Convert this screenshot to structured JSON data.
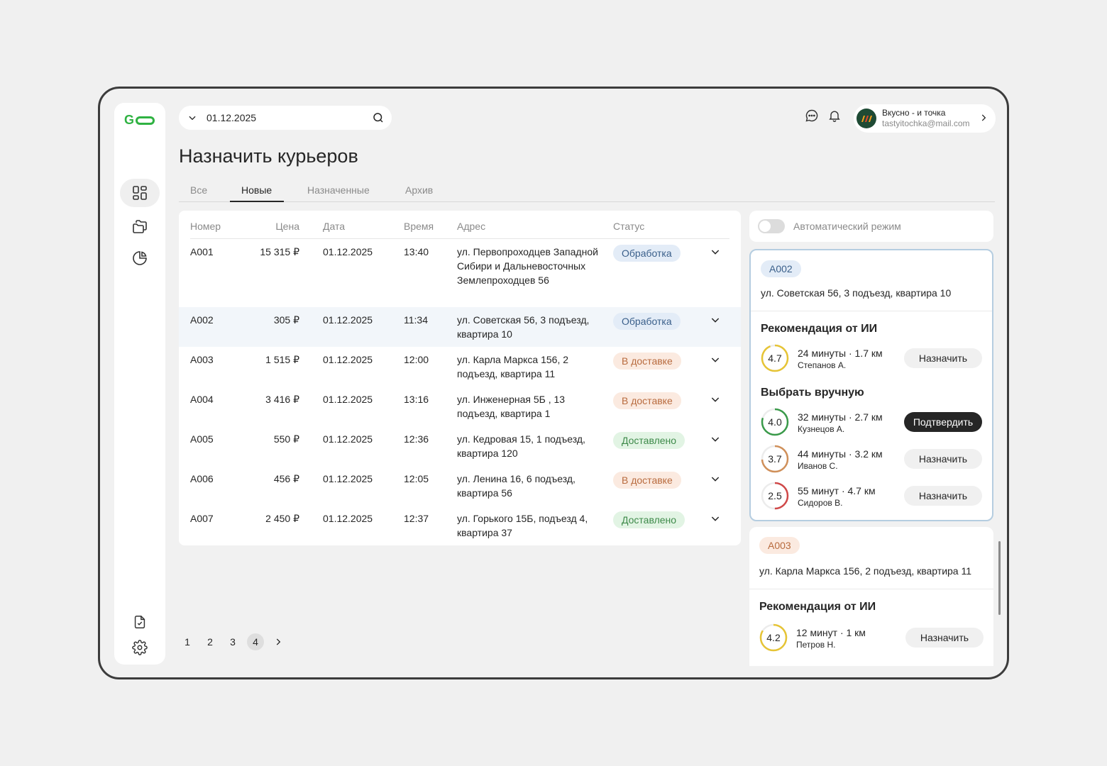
{
  "app": {
    "logo_letter": "G"
  },
  "search": {
    "value": "01.12.2025"
  },
  "user": {
    "name": "Вкусно - и точка",
    "email": "tastyitochka@mail.com"
  },
  "page_title": "Назначить курьеров",
  "tabs": [
    {
      "label": "Все"
    },
    {
      "label": "Новые"
    },
    {
      "label": "Назначенные"
    },
    {
      "label": "Архив"
    }
  ],
  "active_tab": "Новые",
  "table": {
    "headers": {
      "number": "Номер",
      "price": "Цена",
      "date": "Дата",
      "time": "Время",
      "address": "Адрес",
      "status": "Статус"
    },
    "rows": [
      {
        "number": "A001",
        "price": "15 315 ₽",
        "date": "01.12.2025",
        "time": "13:40",
        "address": "ул. Первопроходцев Западной Сибири и Дальневосточных Землепроходцев 56",
        "status": "Обработка",
        "status_type": "proc"
      },
      {
        "number": "A002",
        "price": "305 ₽",
        "date": "01.12.2025",
        "time": "11:34",
        "address": "ул. Советская 56, 3 подъезд, квартира 10",
        "status": "Обработка",
        "status_type": "proc",
        "selected": true
      },
      {
        "number": "A003",
        "price": "1 515 ₽",
        "date": "01.12.2025",
        "time": "12:00",
        "address": "ул. Карла Маркса 156, 2 подъезд, квартира 11",
        "status": "В доставке",
        "status_type": "del"
      },
      {
        "number": "A004",
        "price": "3 416 ₽",
        "date": "01.12.2025",
        "time": "13:16",
        "address": "ул. Инженерная 5Б , 13 подъезд, квартира 1",
        "status": "В доставке",
        "status_type": "del"
      },
      {
        "number": "A005",
        "price": "550 ₽",
        "date": "01.12.2025",
        "time": "12:36",
        "address": "ул. Кедровая 15, 1 подъезд, квартира 120",
        "status": "Доставлено",
        "status_type": "done"
      },
      {
        "number": "A006",
        "price": "456 ₽",
        "date": "01.12.2025",
        "time": "12:05",
        "address": "ул. Ленина 16, 6 подъезд, квартира 56",
        "status": "В доставке",
        "status_type": "del"
      },
      {
        "number": "A007",
        "price": "2 450 ₽",
        "date": "01.12.2025",
        "time": "12:37",
        "address": "ул. Горького 15Б, подъезд 4, квартира 37",
        "status": "Доставлено",
        "status_type": "done"
      }
    ]
  },
  "pagination": {
    "pages": [
      "1",
      "2",
      "3",
      "4"
    ],
    "current": "4"
  },
  "auto_mode": {
    "label": "Автоматический режим",
    "enabled": false
  },
  "orders": [
    {
      "id": "A002",
      "address": "ул. Советская 56, 3 подъезд, квартира 10",
      "ai_title": "Рекомендация от ИИ",
      "ai": {
        "rating": "4.7",
        "rating_value": 4.7,
        "meta": "24 минуты · 1.7 км",
        "name": "Степанов А.",
        "action": "Назначить"
      },
      "manual_title": "Выбрать вручную",
      "manual": [
        {
          "rating": "4.0",
          "rating_value": 4.0,
          "meta": "32 минуты · 2.7 км",
          "name": "Кузнецов А.",
          "action": "Подтвердить"
        },
        {
          "rating": "3.7",
          "rating_value": 3.7,
          "meta": "44 минуты · 3.2 км",
          "name": "Иванов С.",
          "action": "Назначить"
        },
        {
          "rating": "2.5",
          "rating_value": 2.5,
          "meta": "55 минут · 4.7 км",
          "name": "Сидоров В.",
          "action": "Назначить"
        }
      ]
    },
    {
      "id": "A003",
      "address": "ул. Карла Маркса 156, 2 подъезд, квартира 11",
      "ai_title": "Рекомендация от ИИ",
      "ai": {
        "rating": "4.2",
        "rating_value": 4.2,
        "meta": "12 минут · 1 км",
        "name": "Петров Н.",
        "action": "Назначить"
      }
    }
  ],
  "colors": {
    "brand": "#2fb242",
    "processing": "#e3ecf7",
    "delivering": "#fbeae0",
    "delivered": "#e2f4e4",
    "selected_border": "#b5cde0"
  }
}
